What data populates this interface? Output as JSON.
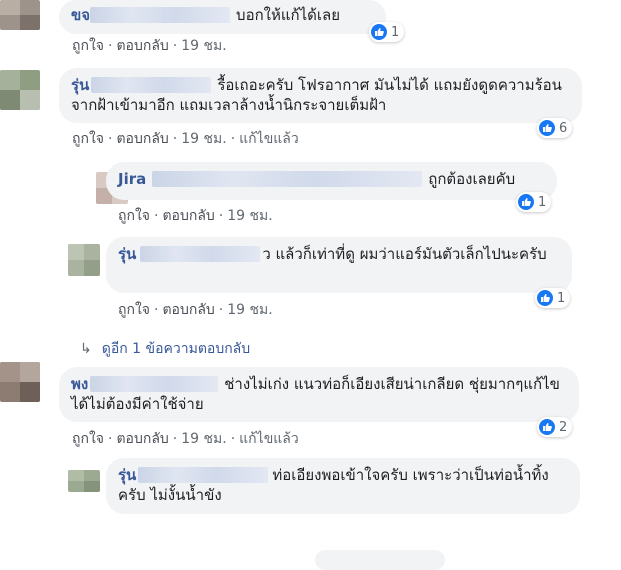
{
  "comments": [
    {
      "name": "ขจ",
      "text": "บอกให้แก้ได้เลย",
      "likes": "1",
      "actions": {
        "like": "ถูกใจ",
        "reply": "ตอบกลับ",
        "time": "19 ชม.",
        "edited": ""
      }
    },
    {
      "name": "รุ่น",
      "text": "รื้อเถอะครับ โฟรอากาศ มันไม่ได้ แถมยังดูดความร้อน จากฝ้าเข้ามาอีก แถมเวลาล้างน้ำนิกระจายเต็มฝ้า",
      "likes": "6",
      "actions": {
        "like": "ถูกใจ",
        "reply": "ตอบกลับ",
        "time": "19 ชม.",
        "edited": "แก้ไขแล้ว"
      }
    },
    {
      "name": "Jira",
      "text": "ถูกต้องเลยคับ",
      "likes": "1",
      "actions": {
        "like": "ถูกใจ",
        "reply": "ตอบกลับ",
        "time": "19 ชม.",
        "edited": ""
      }
    },
    {
      "name": "รุ่น",
      "text": "ว แล้วก็เท่าที่ดู ผมว่าแอร์มันตัวเล็กไปนะครับ",
      "likes": "1",
      "actions": {
        "like": "ถูกใจ",
        "reply": "ตอบกลับ",
        "time": "19 ชม.",
        "edited": ""
      }
    },
    {
      "name": "พง",
      "text": "ช่างไม่เก่ง แนวท่อก็เอียงเสียน่าเกลียด ชุ่ยมากๆแก้ไขได้ไม่ต้องมีค่าใช้จ่าย",
      "likes": "2",
      "actions": {
        "like": "ถูกใจ",
        "reply": "ตอบกลับ",
        "time": "19 ชม.",
        "edited": "แก้ไขแล้ว"
      }
    },
    {
      "name": "รุ่น",
      "text": "ท่อเอียงพอเข้าใจครับ เพราะว่าเป็นท่อน้ำทิ้งครับ ไม่งั้นน้ำขัง",
      "likes": "",
      "actions": {
        "like": "",
        "reply": "",
        "time": "",
        "edited": ""
      }
    }
  ],
  "more_replies": "ดูอีก 1 ข้อความตอบกลับ",
  "sep": "·",
  "colors": {
    "bubble": "#f2f3f5",
    "name": "#385898",
    "meta": "#606770",
    "like": "#1877f2"
  }
}
